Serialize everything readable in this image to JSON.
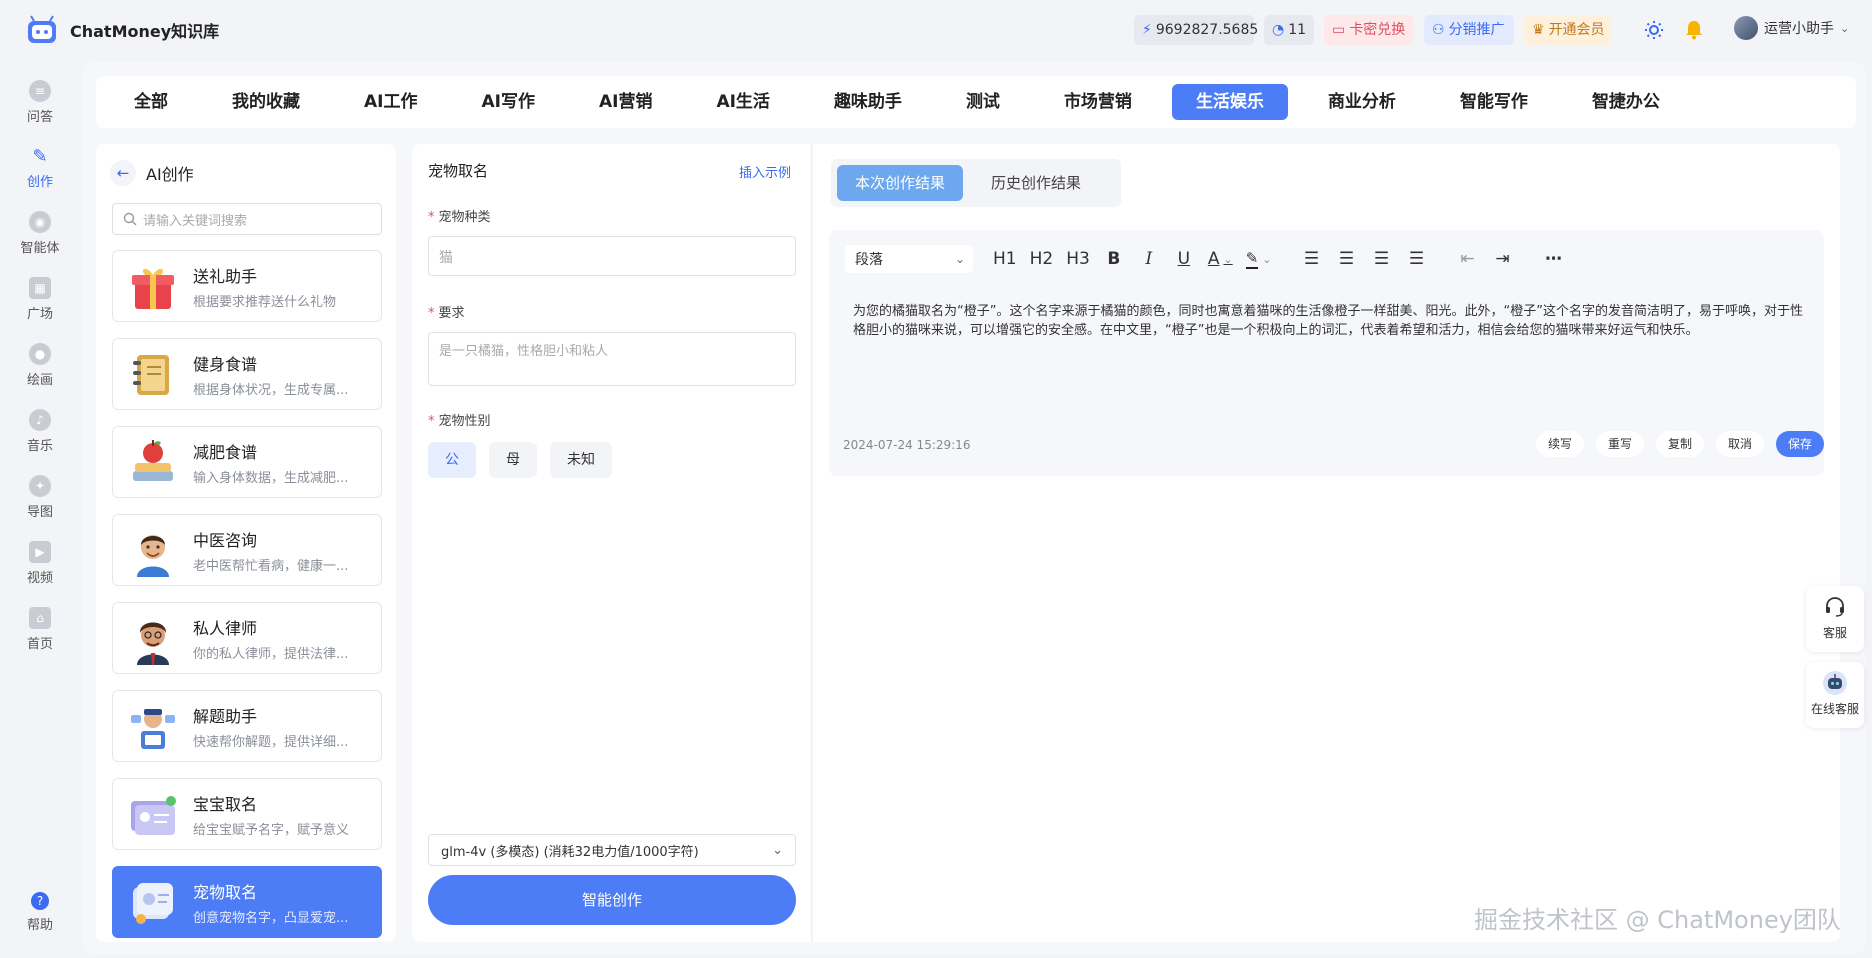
{
  "header": {
    "app_title": "ChatMoney知识库",
    "power_value": "9692827.5685",
    "chat_count": "11",
    "card_label": "卡密兑换",
    "share_label": "分销推广",
    "vip_label": "开通会员",
    "username": "运营小助手"
  },
  "nav": {
    "items": [
      {
        "label": "问答"
      },
      {
        "label": "创作"
      },
      {
        "label": "智能体"
      },
      {
        "label": "广场"
      },
      {
        "label": "绘画"
      },
      {
        "label": "音乐"
      },
      {
        "label": "导图"
      },
      {
        "label": "视频"
      },
      {
        "label": "首页"
      }
    ],
    "help_label": "帮助"
  },
  "categories": [
    "全部",
    "我的收藏",
    "AI工作",
    "AI写作",
    "AI营销",
    "AI生活",
    "趣味助手",
    "测试",
    "市场营销",
    "生活娱乐",
    "商业分析",
    "智能写作",
    "智捷办公"
  ],
  "active_category": "生活娱乐",
  "left_panel": {
    "title": "AI创作",
    "search_placeholder": "请输入关键词搜索",
    "cards": [
      {
        "title": "送礼助手",
        "desc": "根据要求推荐送什么礼物",
        "color": "#e8434a"
      },
      {
        "title": "健身食谱",
        "desc": "根据身体状况，生成专属...",
        "color": "#d8a848"
      },
      {
        "title": "减肥食谱",
        "desc": "输入身体数据，生成减肥...",
        "color": "#9bb7d8"
      },
      {
        "title": "中医咨询",
        "desc": "老中医帮忙看病，健康一...",
        "color": "#6b4a36"
      },
      {
        "title": "私人律师",
        "desc": "你的私人律师，提供法律...",
        "color": "#5a3a28"
      },
      {
        "title": "解题助手",
        "desc": "快速帮你解题，提供详细...",
        "color": "#4a7ed8"
      },
      {
        "title": "宝宝取名",
        "desc": "给宝宝赋予名字，赋予意义",
        "color": "#a8a6e8"
      },
      {
        "title": "宠物取名",
        "desc": "创意宠物名字，凸显爱宠...",
        "color": "#c8d4f4"
      }
    ]
  },
  "form": {
    "title": "宠物取名",
    "insert_example": "插入示例",
    "pet_type_label": "宠物种类",
    "pet_type_placeholder": "猫",
    "requirement_label": "要求",
    "requirement_placeholder": "是一只橘猫，性格胆小和粘人",
    "gender_label": "宠物性别",
    "gender_options": [
      "公",
      "母",
      "未知"
    ],
    "gender_selected": "公",
    "model": "glm-4v (多模态) (消耗32电力值/1000字符)",
    "create_label": "智能创作"
  },
  "result": {
    "tab_current": "本次创作结果",
    "tab_history": "历史创作结果",
    "paragraph_select": "段落",
    "toolbar": {
      "h1": "H1",
      "h2": "H2",
      "h3": "H3",
      "bold": "B",
      "italic": "I",
      "underline": "U",
      "font_color": "A"
    },
    "content": "为您的橘猫取名为“橙子”。这个名字来源于橘猫的颜色，同时也寓意着猫咪的生活像橙子一样甜美、阳光。此外，“橙子”这个名字的发音简洁明了，易于呼唤，对于性格胆小的猫咪来说，可以增强它的安全感。在中文里，“橙子”也是一个积极向上的词汇，代表着希望和活力，相信会给您的猫咪带来好运气和快乐。",
    "timestamp": "2024-07-24 15:29:16",
    "actions": [
      "续写",
      "重写",
      "复制",
      "取消",
      "保存"
    ]
  },
  "floating": {
    "service_label": "客服",
    "online_label": "在线客服"
  },
  "watermark": "掘金技术社区 @ ChatMoney团队",
  "colors": {
    "accent": "#4d7cf7",
    "tab_active": "#6da8ee"
  }
}
